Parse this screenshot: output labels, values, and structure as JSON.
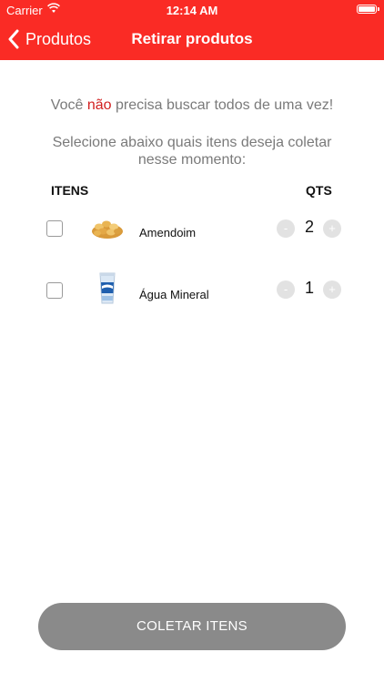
{
  "status_bar": {
    "carrier": "Carrier",
    "time": "12:14 AM",
    "wifi_icon": "wifi-icon",
    "battery_icon": "battery-icon"
  },
  "nav": {
    "back_label": "Produtos",
    "back_icon": "chevron-left-icon",
    "title": "Retirar produtos"
  },
  "message": {
    "line1_before": "Você ",
    "line1_highlight": "não",
    "line1_after": " precisa buscar todos de uma vez!",
    "line2": "Selecione abaixo quais itens deseja coletar nesse momento:"
  },
  "table": {
    "header_items": "ITENS",
    "header_qty": "QTS",
    "rows": [
      {
        "name": "Amendoim",
        "qty": "2",
        "checked": false,
        "thumb_icon": "peanuts-icon",
        "minus": "-",
        "plus": "+"
      },
      {
        "name": "Água Mineral",
        "qty": "1",
        "checked": false,
        "thumb_icon": "water-cup-icon",
        "minus": "-",
        "plus": "+"
      }
    ]
  },
  "actions": {
    "collect_label": "COLETAR ITENS"
  },
  "colors": {
    "brand_red": "#fa2b25",
    "highlight_red": "#d11f1f",
    "button_gray": "#8a8a8a",
    "stepper_gray": "#e2e2e2"
  }
}
